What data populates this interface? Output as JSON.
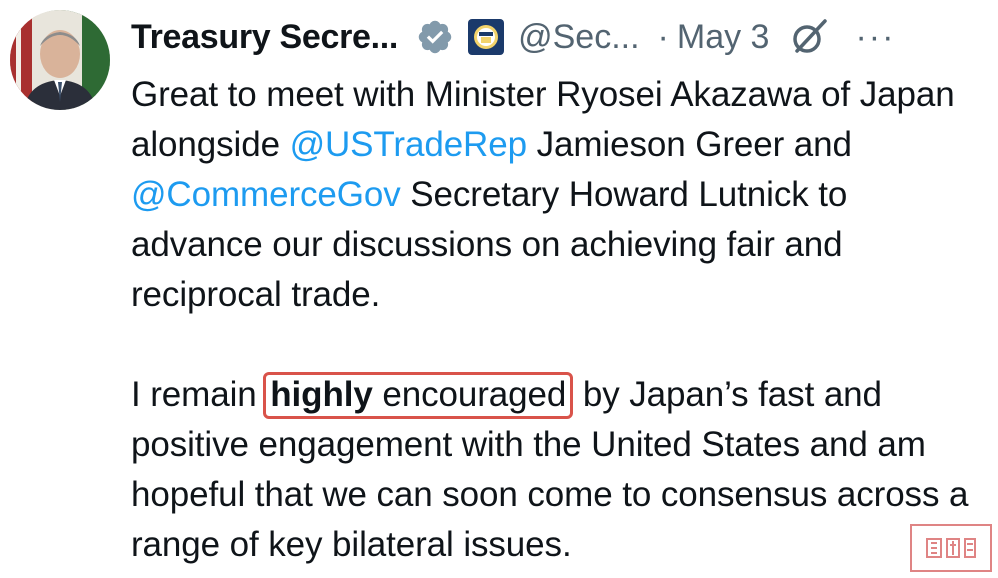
{
  "tweet": {
    "author_name": "Treasury Secre...",
    "handle": "@Sec...",
    "separator": "·",
    "date": "May 3",
    "more": "···",
    "para1": {
      "t1": "Great to meet with Minister Ryosei Akazawa of Japan alongside ",
      "m1": "@USTradeRep",
      "t2": " Jamieson Greer and ",
      "m2": "@CommerceGov",
      "t3": " Secretary Howard Lutnick to advance our discussions on achieving fair and reciprocal trade."
    },
    "para2": {
      "t1": "I remain ",
      "hl_bold": "highly",
      "hl_rest": " encouraged",
      "t2": " by Japan’s fast and positive engagement with the United States and am hopeful that we can soon come to consensus across a range of key bilateral issues."
    }
  },
  "colors": {
    "mention": "#1d9bf0",
    "secondary_text": "#536471",
    "highlight_box": "#d9534a",
    "verified_badge": "#829aab"
  },
  "icons": [
    "avatar",
    "verified-icon",
    "treasury-seal-icon",
    "grok-icon",
    "more-icon"
  ]
}
